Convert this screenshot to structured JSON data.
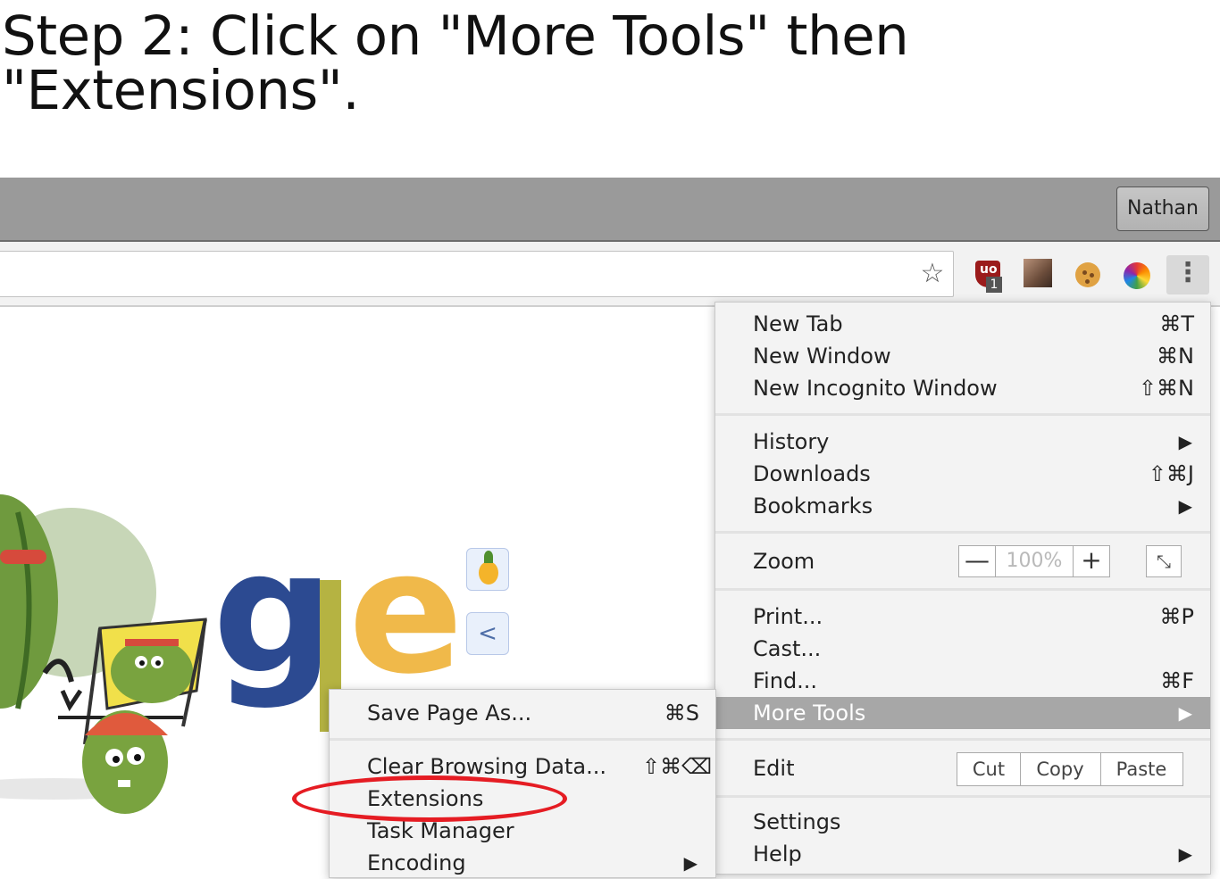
{
  "caption": {
    "line1": "Step 2: Click on \"More Tools\" then",
    "line2": "\"Extensions\"."
  },
  "titlebar": {
    "profile": "Nathan"
  },
  "toolbar": {
    "extensions": [
      {
        "name": "ublock-icon",
        "badge": "1"
      },
      {
        "name": "profile-photo-icon"
      },
      {
        "name": "cookie-icon"
      },
      {
        "name": "color-wheel-icon"
      }
    ],
    "menu_icon": "⋮",
    "star_icon": "☆"
  },
  "menu": {
    "new_tab": {
      "label": "New Tab",
      "shortcut": "⌘T"
    },
    "new_window": {
      "label": "New Window",
      "shortcut": "⌘N"
    },
    "new_incognito": {
      "label": "New Incognito Window",
      "shortcut": "⇧⌘N"
    },
    "history": {
      "label": "History",
      "arrow": "▶"
    },
    "downloads": {
      "label": "Downloads",
      "shortcut": "⇧⌘J"
    },
    "bookmarks": {
      "label": "Bookmarks",
      "arrow": "▶"
    },
    "zoom": {
      "label": "Zoom",
      "minus": "—",
      "value": "100%",
      "plus": "+",
      "fullscreen": "⤡"
    },
    "print": {
      "label": "Print...",
      "shortcut": "⌘P"
    },
    "cast": {
      "label": "Cast..."
    },
    "find": {
      "label": "Find...",
      "shortcut": "⌘F"
    },
    "more_tools": {
      "label": "More Tools",
      "arrow": "▶"
    },
    "edit": {
      "label": "Edit",
      "cut": "Cut",
      "copy": "Copy",
      "paste": "Paste"
    },
    "settings": {
      "label": "Settings"
    },
    "help": {
      "label": "Help",
      "arrow": "▶"
    }
  },
  "submenu": {
    "save_page": {
      "label": "Save Page As...",
      "shortcut": "⌘S"
    },
    "clear_data": {
      "label": "Clear Browsing Data...",
      "shortcut": "⇧⌘⌫"
    },
    "extensions": {
      "label": "Extensions"
    },
    "task_manager": {
      "label": "Task Manager"
    },
    "encoding": {
      "label": "Encoding",
      "arrow": "▶"
    }
  },
  "colors": {
    "selected": "#a7a7a7",
    "highlight_ellipse": "#e51c23",
    "titlebar": "#9a9a9a"
  }
}
